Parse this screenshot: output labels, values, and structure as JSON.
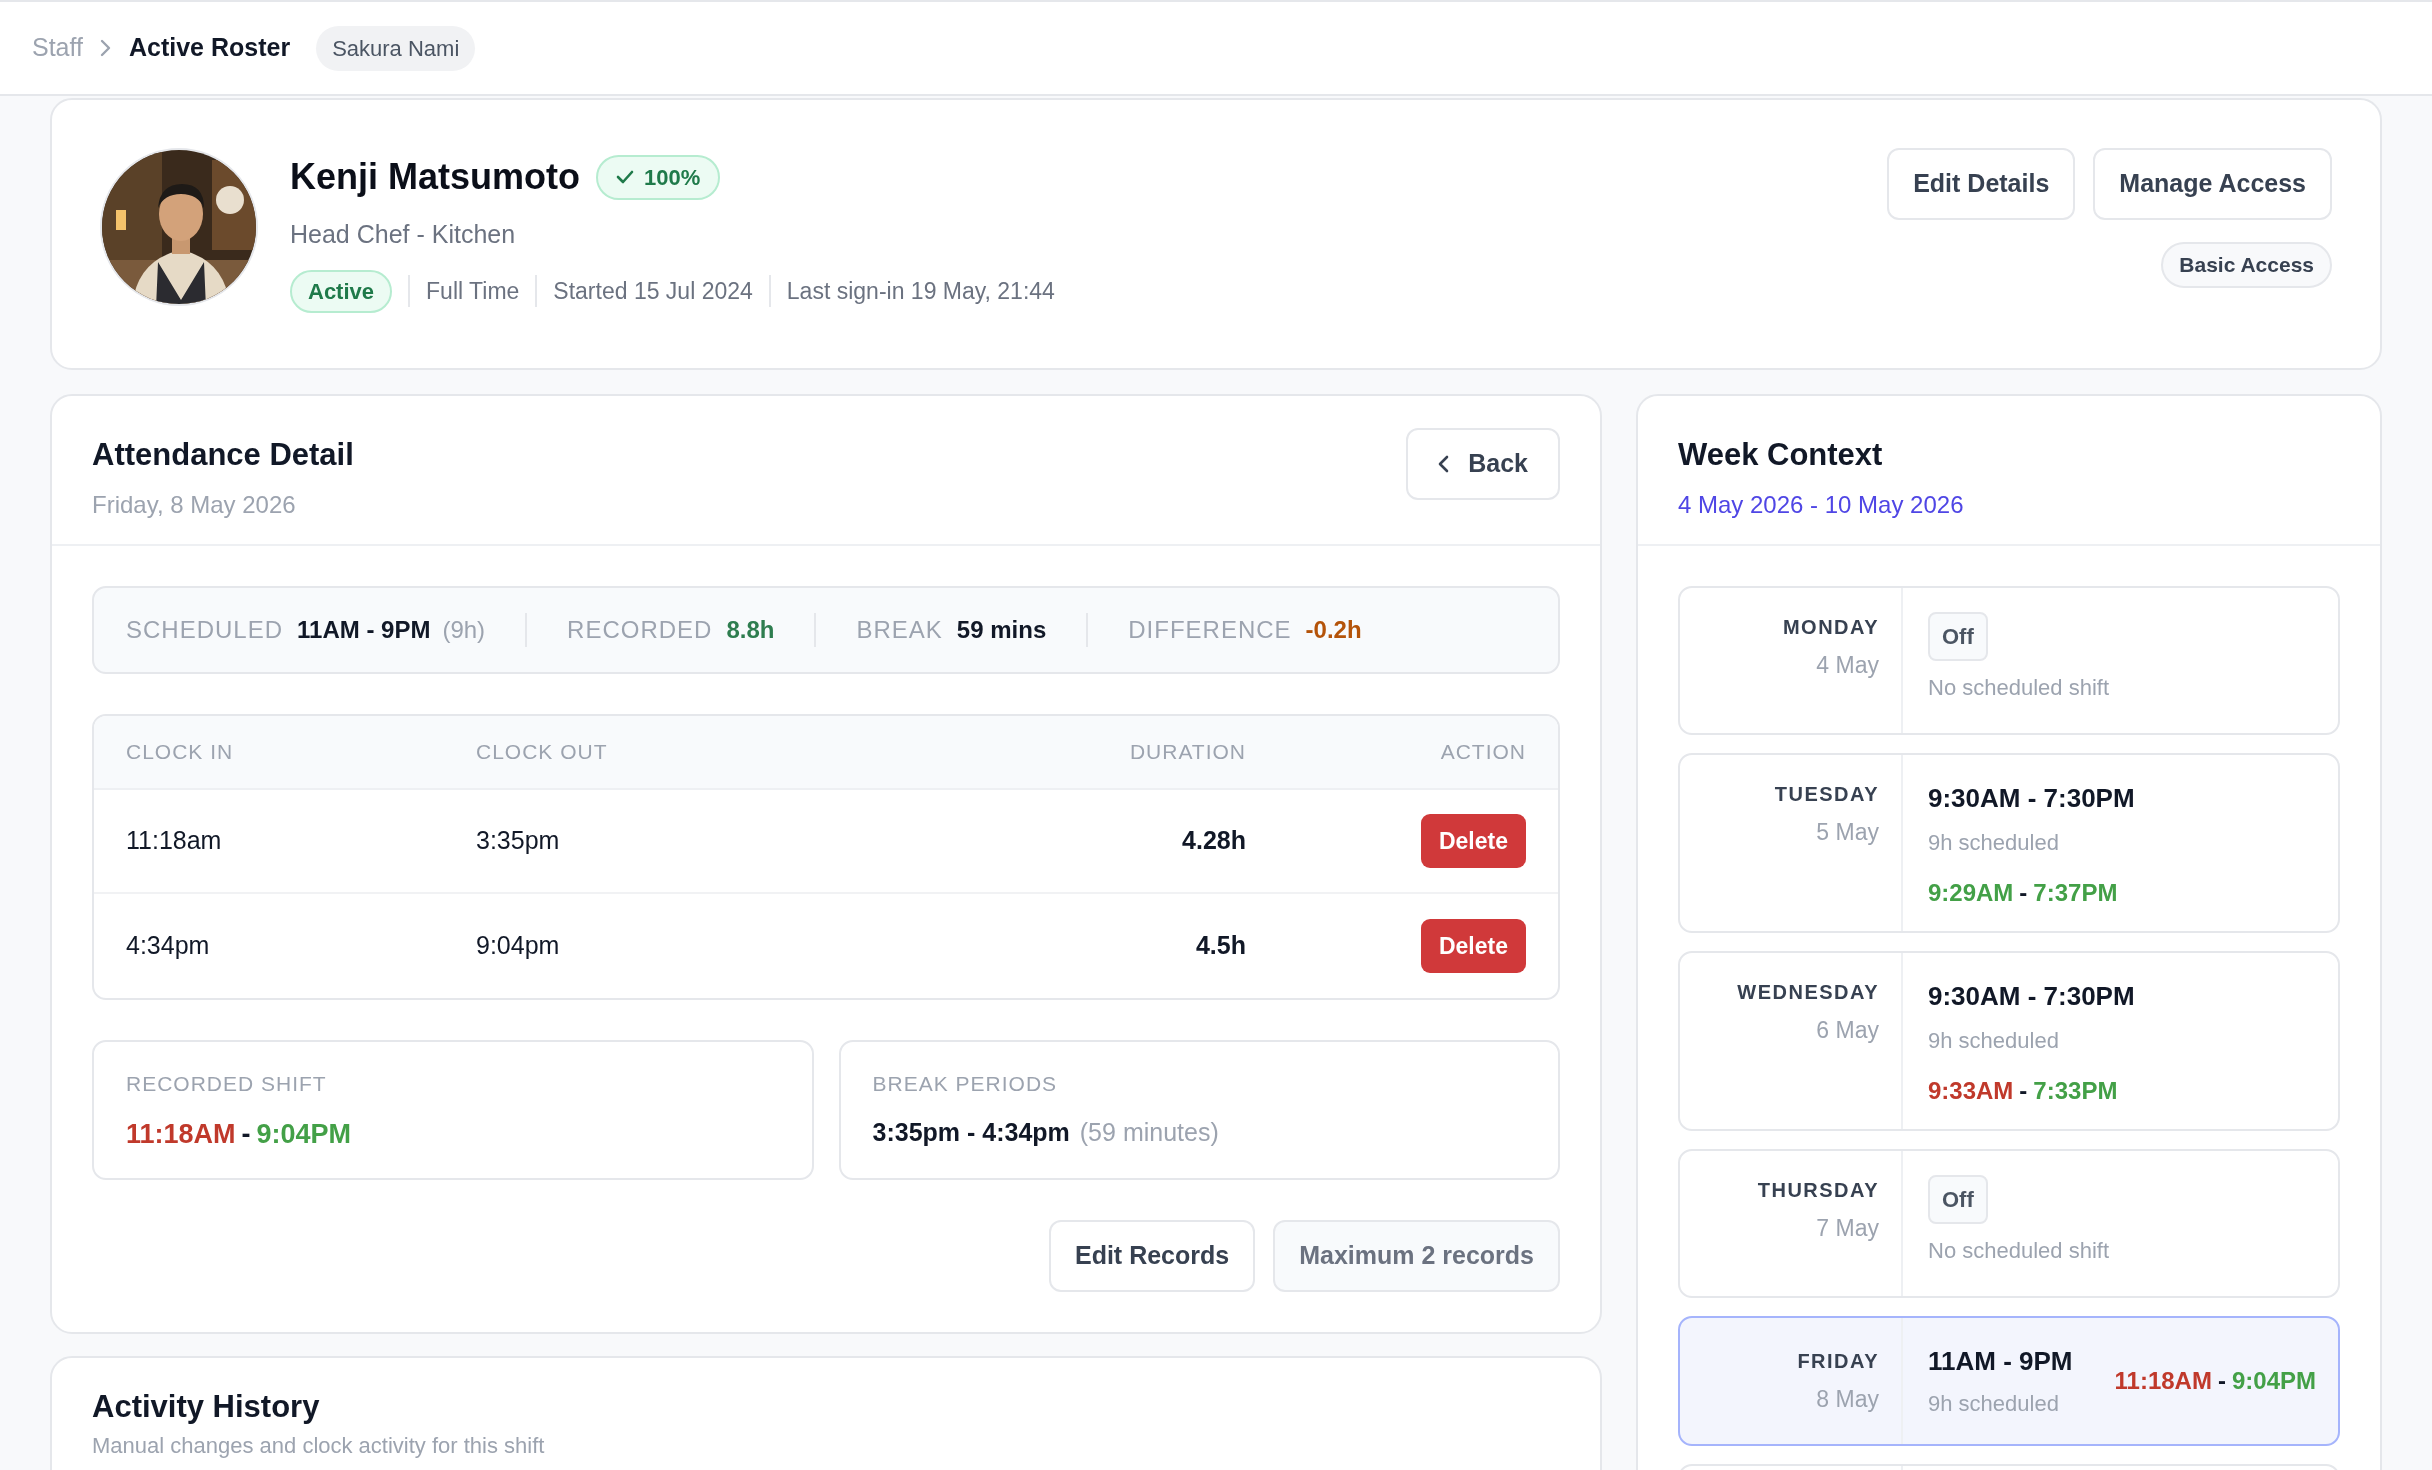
{
  "breadcrumb": {
    "items": [
      {
        "label": "Staff",
        "current": false
      },
      {
        "label": "Active Roster",
        "current": true
      }
    ],
    "tag": "Sakura Nami"
  },
  "profile": {
    "photo": {
      "kind": "picture"
    },
    "name": "Kenji Matsumoto",
    "score": "100%",
    "role": "Head Chef - Kitchen",
    "status": "Active",
    "meta": [
      "Full Time",
      "Started 15 Jul 2024",
      "Last sign-in 19 May, 21:44"
    ],
    "buttons": [
      "Edit Details",
      "Manage Access"
    ],
    "access": "Basic Access"
  },
  "attendance": {
    "title": "Attendance Detail",
    "date": "Friday, 8 May 2026",
    "back": "Back",
    "summary": [
      {
        "label": "SCHEDULED",
        "value": "11AM - 9PM",
        "note": "(9h)",
        "color": "#111827"
      },
      {
        "label": "RECORDED",
        "value": "8.8h",
        "color": "#2e7d4f"
      },
      {
        "label": "BREAK",
        "value": "59 mins",
        "color": "#111827"
      },
      {
        "label": "DIFFERENCE",
        "value": "-0.2h",
        "color": "#b45309"
      }
    ],
    "table": {
      "columns": [
        "CLOCK IN",
        "CLOCK OUT",
        "DURATION",
        "ACTION"
      ],
      "rows": [
        {
          "clock_in": "11:18am",
          "clock_out": "3:35pm",
          "duration": "4.28h",
          "action": "Delete"
        },
        {
          "clock_in": "4:34pm",
          "clock_out": "9:04pm",
          "duration": "4.5h",
          "action": "Delete"
        }
      ]
    },
    "recorded_shift": {
      "label": "RECORDED SHIFT",
      "start": {
        "time": "11:18AM",
        "late": true
      },
      "separator": "-",
      "end": {
        "time": "9:04PM",
        "late": false
      }
    },
    "break_periods": {
      "label": "BREAK PERIODS",
      "value": "3:35pm - 4:34pm",
      "note": "(59 minutes)"
    },
    "buttons": [
      {
        "label": "Edit Records",
        "disabled": false
      },
      {
        "label": "Maximum 2 records",
        "disabled": true
      }
    ]
  },
  "activity": {
    "title": "Activity History",
    "subtitle": "Manual changes and clock activity for this shift"
  },
  "week": {
    "title": "Week Context",
    "range": "4 May 2026 - 10 May 2026",
    "days": [
      {
        "kind": "off",
        "day": "MONDAY",
        "date": "4 May",
        "badge": "Off",
        "note": "No scheduled shift",
        "selected": false
      },
      {
        "kind": "shift",
        "day": "TUESDAY",
        "date": "5 May",
        "scheduled": "9:30AM - 7:30PM",
        "hours": "9h scheduled",
        "start": {
          "time": "9:29AM",
          "late": false
        },
        "separator": "-",
        "end": {
          "time": "7:37PM",
          "late": false
        },
        "selected": false
      },
      {
        "kind": "shift",
        "day": "WEDNESDAY",
        "date": "6 May",
        "scheduled": "9:30AM - 7:30PM",
        "hours": "9h scheduled",
        "start": {
          "time": "9:33AM",
          "late": true
        },
        "separator": "-",
        "end": {
          "time": "7:33PM",
          "late": false
        },
        "selected": false
      },
      {
        "kind": "off",
        "day": "THURSDAY",
        "date": "7 May",
        "badge": "Off",
        "note": "No scheduled shift",
        "selected": false
      },
      {
        "kind": "shift",
        "day": "FRIDAY",
        "date": "8 May",
        "scheduled": "11AM - 9PM",
        "hours": "9h scheduled",
        "start": {
          "time": "11:18AM",
          "late": true
        },
        "separator": "-",
        "end": {
          "time": "9:04PM",
          "late": false
        },
        "selected": true
      }
    ]
  }
}
